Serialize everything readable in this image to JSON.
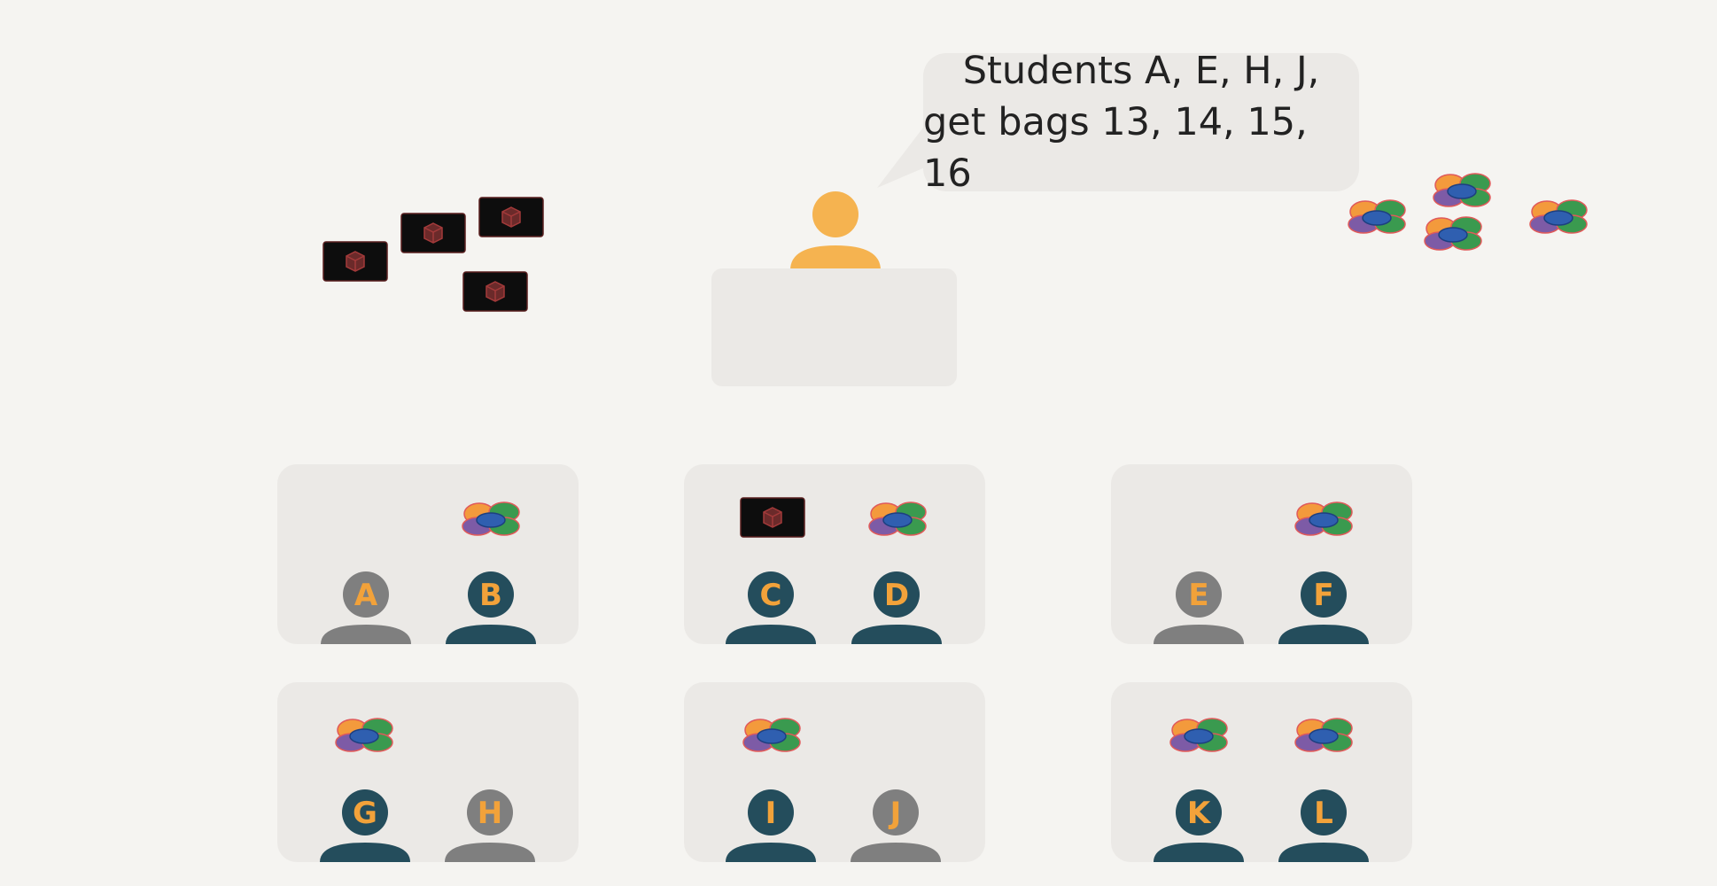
{
  "speech": {
    "line1": "Students A, E, H, J,",
    "line2": "get bags 13, 14, 15, 16"
  },
  "colors": {
    "background": "#f5f4f1",
    "table": "#ebe9e6",
    "teacher": "#f5b350",
    "student_active": "#244d5c",
    "student_inactive": "#7f7f7f",
    "letter": "#f2a23a",
    "black_bag": "#0d0d0d",
    "black_bag_icon": "#7a2b2b"
  },
  "students": [
    {
      "id": "A",
      "label": "A",
      "state": "inactive"
    },
    {
      "id": "B",
      "label": "B",
      "state": "active"
    },
    {
      "id": "C",
      "label": "C",
      "state": "active"
    },
    {
      "id": "D",
      "label": "D",
      "state": "active"
    },
    {
      "id": "E",
      "label": "E",
      "state": "inactive"
    },
    {
      "id": "F",
      "label": "F",
      "state": "active"
    },
    {
      "id": "G",
      "label": "G",
      "state": "active"
    },
    {
      "id": "H",
      "label": "H",
      "state": "inactive"
    },
    {
      "id": "I",
      "label": "I",
      "state": "active"
    },
    {
      "id": "J",
      "label": "J",
      "state": "inactive"
    },
    {
      "id": "K",
      "label": "K",
      "state": "active"
    },
    {
      "id": "L",
      "label": "L",
      "state": "active"
    }
  ],
  "icons": {
    "black_bag": "black-bag-icon",
    "color_bag": "color-bag-icon",
    "teacher": "teacher-icon",
    "student": "student-icon"
  }
}
